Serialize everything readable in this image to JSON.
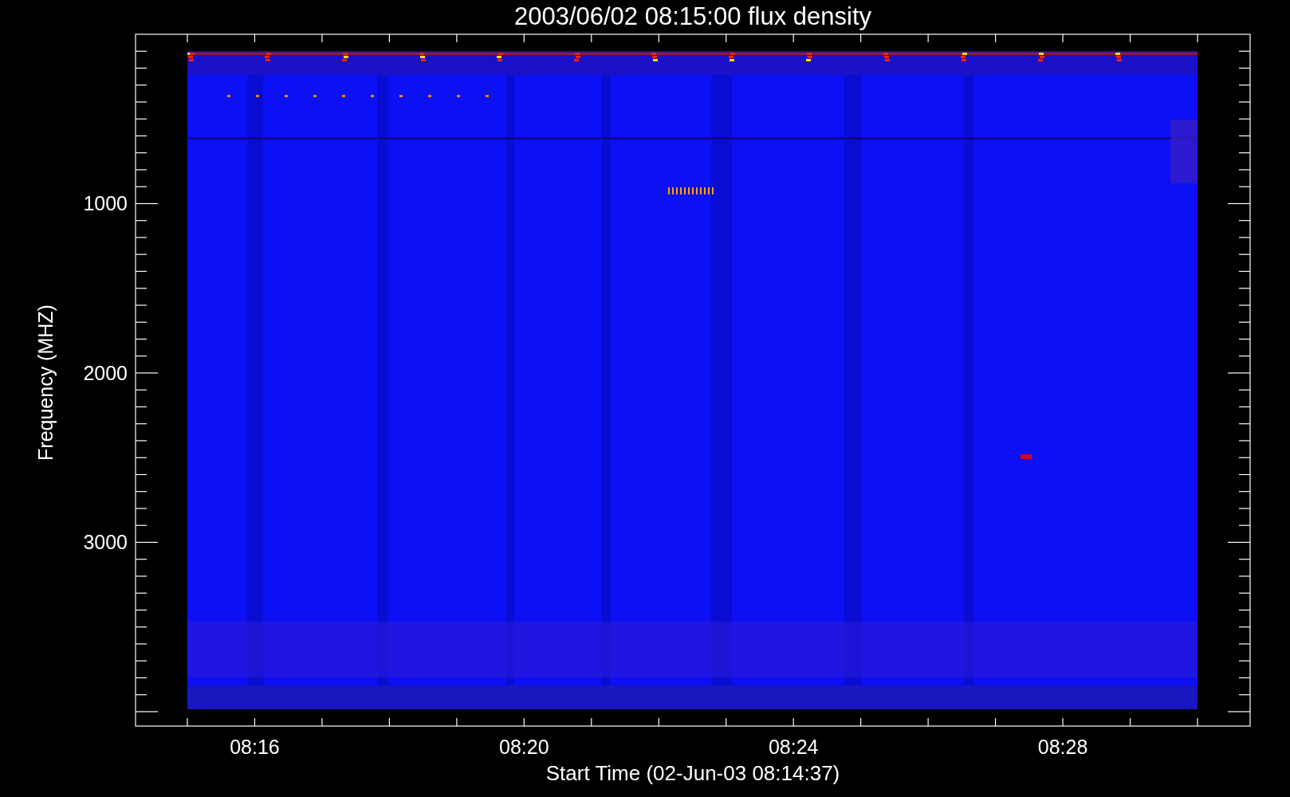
{
  "plot": {
    "title": "2003/06/02 08:15:00 flux density",
    "y_axis": {
      "label": "Frequency (MHZ)",
      "tick_labels": [
        "1000",
        "2000",
        "3000"
      ]
    },
    "x_axis": {
      "label": "Start Time (02-Jun-03 08:14:37)",
      "tick_labels": [
        "08:16",
        "08:20",
        "08:24",
        "08:28"
      ]
    }
  }
}
